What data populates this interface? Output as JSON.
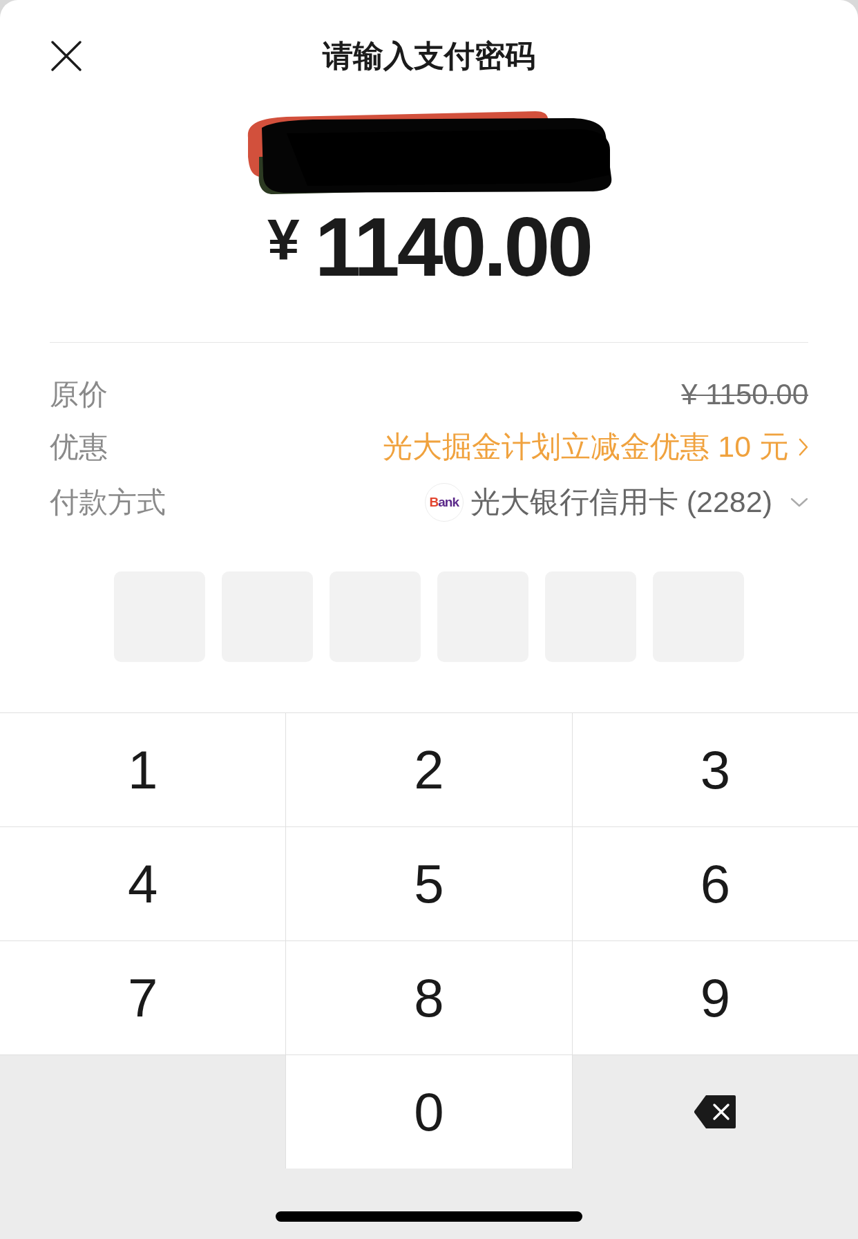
{
  "header": {
    "title": "请输入支付密码"
  },
  "amount": {
    "currency": "¥",
    "value": "1140.00"
  },
  "details": [
    {
      "kind": "original_price",
      "label": "原价",
      "value": "¥ 1150.00"
    },
    {
      "kind": "discount",
      "label": "优惠",
      "value": "光大掘金计划立减金优惠 10 元"
    },
    {
      "kind": "payment_method",
      "label": "付款方式",
      "logo": "Bank",
      "value": "光大银行信用卡 (2282)"
    }
  ],
  "pin": [
    {
      "filled": false
    },
    {
      "filled": false
    },
    {
      "filled": false
    },
    {
      "filled": false
    },
    {
      "filled": false
    },
    {
      "filled": false
    }
  ],
  "keypad": [
    {
      "kind": "digit",
      "label": "1"
    },
    {
      "kind": "digit",
      "label": "2"
    },
    {
      "kind": "digit",
      "label": "3"
    },
    {
      "kind": "digit",
      "label": "4"
    },
    {
      "kind": "digit",
      "label": "5"
    },
    {
      "kind": "digit",
      "label": "6"
    },
    {
      "kind": "digit",
      "label": "7"
    },
    {
      "kind": "digit",
      "label": "8"
    },
    {
      "kind": "digit",
      "label": "9"
    },
    {
      "kind": "blank"
    },
    {
      "kind": "digit",
      "label": "0"
    },
    {
      "kind": "backspace"
    }
  ]
}
